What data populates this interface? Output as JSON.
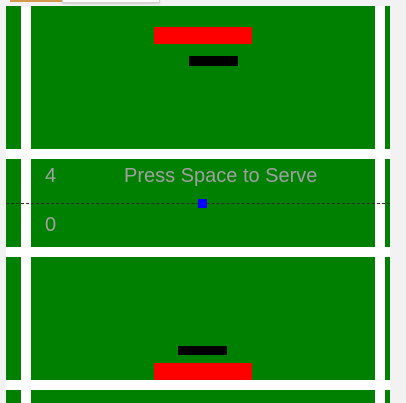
{
  "scores": {
    "opponent": "4",
    "player": "0"
  },
  "message": "Press Space to Serve",
  "colors": {
    "court": "#008000",
    "lines": "#ffffff",
    "red_paddle": "#ff0000",
    "black_paddle": "#000000",
    "ball": "#0000ff",
    "text": "#a0a0a0"
  }
}
